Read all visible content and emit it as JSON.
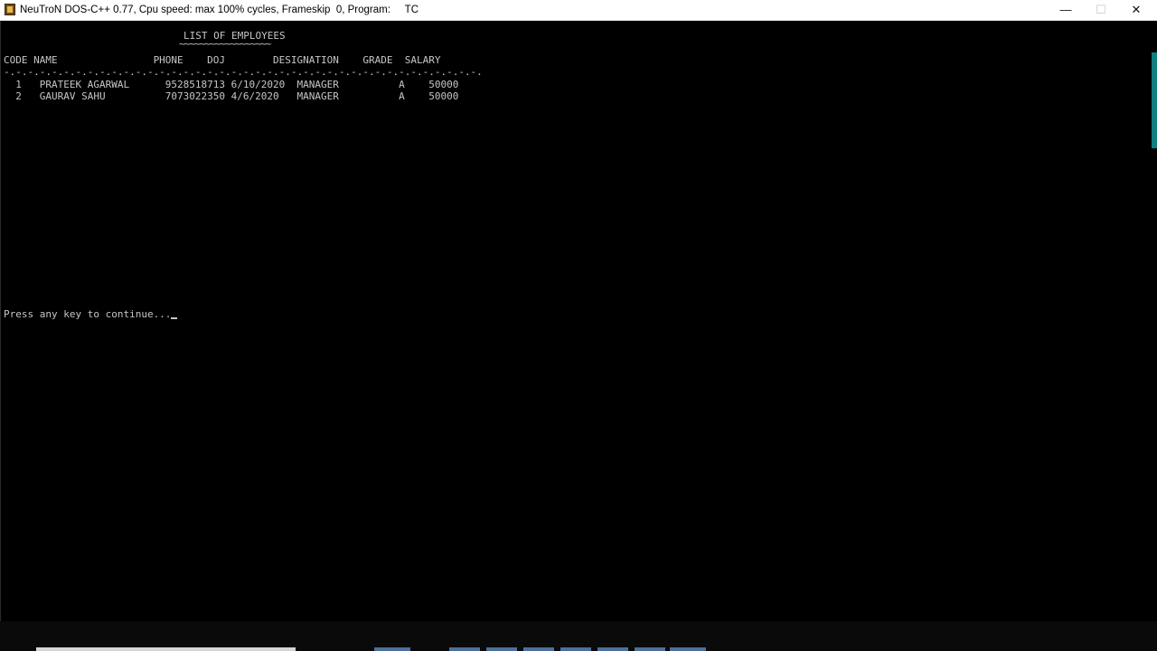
{
  "window": {
    "title": "NeuTroN DOS-C++ 0.77, Cpu speed: max 100% cycles, Frameskip  0, Program:     TC",
    "minimize_glyph": "—",
    "maximize_glyph": "☐",
    "close_glyph": "✕"
  },
  "console": {
    "heading": "LIST OF EMPLOYEES",
    "heading_underline": "~~~~~~~~~~~~~~~~~~",
    "header_line": "CODE NAME                PHONE    DOJ        DESIGNATION    GRADE  SALARY",
    "separator": "-.-.-.-.-.-.-.-.-.-.-.-.-.-.-.-.-.-.-.-.-.-.-.-.-.-.-.-.-.-.-.-.-.-.-.-.-.-.-.-.",
    "rows": [
      "  1   PRATEEK AGARWAL      9528518713 6/10/2020  MANAGER          A    50000",
      "  2   GAURAV SAHU          7073022350 4/6/2020   MANAGER          A    50000"
    ],
    "prompt": "Press any key to continue..."
  },
  "colors": {
    "console_text": "#c6c6c6",
    "background": "#000000",
    "accent": "#0f7f7f"
  }
}
